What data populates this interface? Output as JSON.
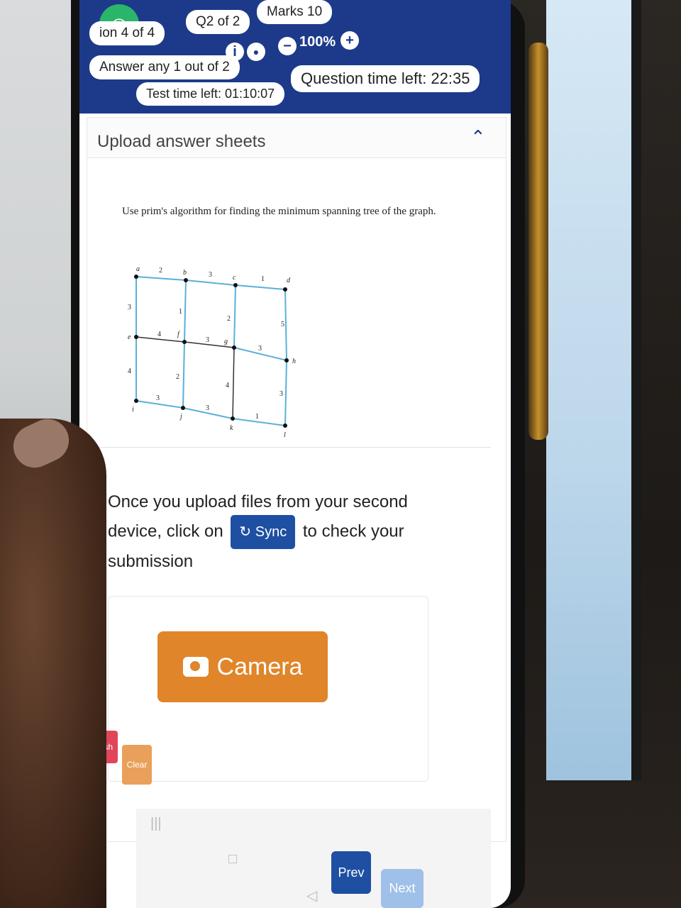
{
  "header": {
    "question_counter": "ion 4 of 4",
    "subquestion": "Q2 of 2",
    "marks": "Marks 10",
    "instruction": "Answer any 1 out of 2",
    "zoom_level": "100%",
    "test_time": "Test time left: 01:10:07",
    "question_time": "Question time left: 22:35"
  },
  "card": {
    "title": "Upload answer sheets"
  },
  "question": {
    "text": "Use prim's algorithm for finding the minimum spanning tree of the graph.",
    "graph": {
      "nodes": [
        "a",
        "b",
        "c",
        "d",
        "e",
        "f",
        "g",
        "h",
        "i",
        "j",
        "k",
        "l"
      ],
      "edge_weights": [
        "2",
        "3",
        "1",
        "3",
        "1",
        "2",
        "5",
        "4",
        "3",
        "3",
        "2",
        "4",
        "3",
        "3",
        "4",
        "1",
        "3"
      ]
    }
  },
  "upload": {
    "line_before": "Once you upload files from your second device, click on",
    "sync_label": "Sync",
    "line_after": "to check your submission",
    "camera_label": "Camera"
  },
  "footer": {
    "prev_label": "Prev",
    "next_label": "Next",
    "finish_label": "Finish",
    "clear_label": "Clear"
  },
  "colors": {
    "header_bg": "#1d3a8a",
    "sync_bg": "#1e4fa3",
    "camera_bg": "#e0852a",
    "badge_green": "#2bb56a"
  }
}
